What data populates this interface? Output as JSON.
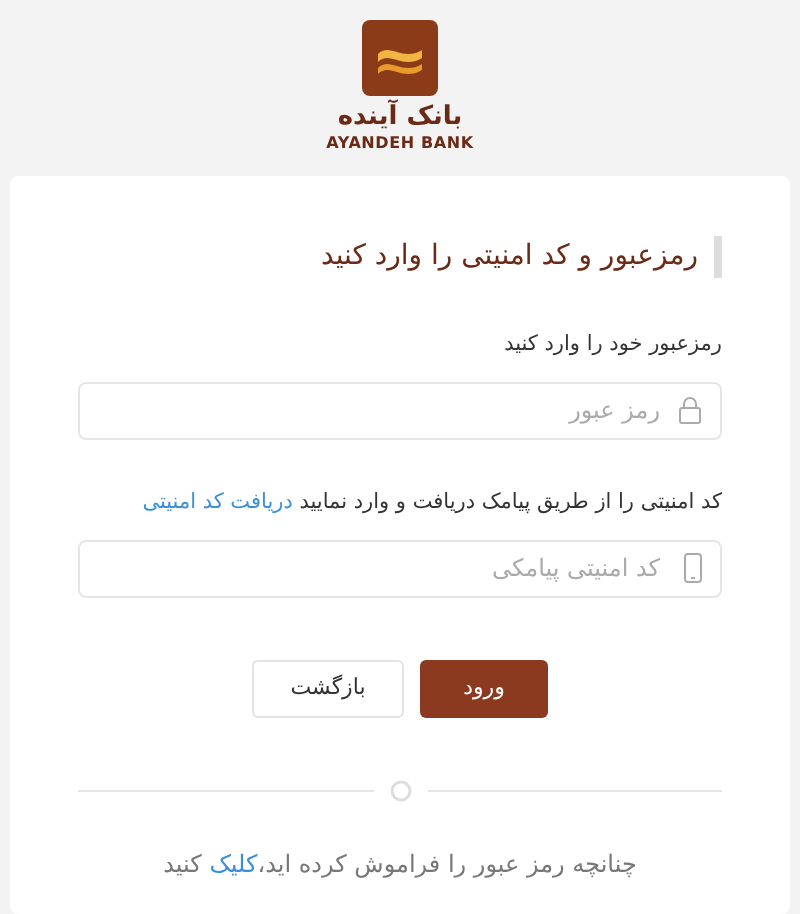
{
  "logo": {
    "name": "بانک آینده",
    "latin": "AYANDEH BANK"
  },
  "title": "رمزعبور و کد امنیتی را وارد کنید",
  "password": {
    "label": "رمزعبور خود را وارد کنید",
    "placeholder": "رمز عبور"
  },
  "code": {
    "label": "کد امنیتی را از طریق پیامک دریافت و وارد نمایید",
    "link": "دریافت کد امنیتی",
    "placeholder": "کد امنیتی پیامکی"
  },
  "buttons": [
    {
      "label": "ورود",
      "kind": "primary"
    },
    {
      "label": "بازگشت",
      "kind": "secondary"
    }
  ],
  "forgot": {
    "text": "چنانچه رمز عبور را فراموش کرده اید،",
    "link": "کلیک",
    "after": " کنید"
  }
}
